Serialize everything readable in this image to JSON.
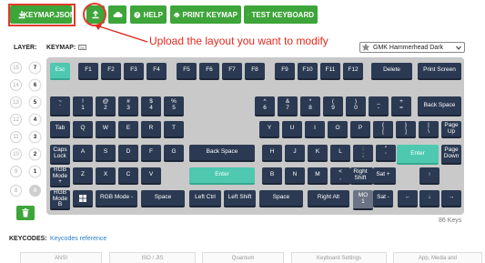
{
  "toolbar": {
    "keymap_json": "KEYMAP.JSON",
    "help": "HELP",
    "print_keymap": "PRINT KEYMAP",
    "test_keyboard": "TEST KEYBOARD"
  },
  "annotation": "Upload the layout you want to modify",
  "layer_label": "LAYER:",
  "keymap_label": "KEYMAP:",
  "theme_select": "GMK Hammerhead Dark",
  "keys_count": "86 Keys",
  "keycodes_label": "KEYCODES:",
  "keycodes_link": "Keycodes reference",
  "layers_left": [
    "15",
    "14",
    "13",
    "12",
    "11",
    "10",
    "9",
    "8"
  ],
  "layers_right": [
    "7",
    "6",
    "5",
    "4",
    "3",
    "2",
    "1",
    "0"
  ],
  "keys": {
    "esc": "Esc",
    "f1": "F1",
    "f2": "F2",
    "f3": "F3",
    "f4": "F4",
    "f5": "F5",
    "f6": "F6",
    "f7": "F7",
    "f8": "F8",
    "f9": "F9",
    "f10": "F10",
    "f11": "F11",
    "f12": "F12",
    "delete": "Delete",
    "printscreen": "Print Screen",
    "tilde": "~\n`",
    "n1": "!\n1",
    "n2": "@\n2",
    "n3": "#\n3",
    "n4": "$\n4",
    "n5": "%\n5",
    "n6": "^\n6",
    "n7": "&\n7",
    "n8": "*\n8",
    "n9": "(\n9",
    "n0": ")\n0",
    "minus": "_\n-",
    "equal": "+\n=",
    "backspace": "Back Space",
    "tab": "Tab",
    "q": "Q",
    "w": "W",
    "e": "E",
    "r": "R",
    "t": "T",
    "y": "Y",
    "u": "U",
    "i": "I",
    "o": "O",
    "p": "P",
    "lbr": "{\n[",
    "rbr": "}\n]",
    "bslash": "|\n\\",
    "pgup": "Page\nUp",
    "caps": "Caps\nLock",
    "a": "A",
    "s": "S",
    "d": "D",
    "f": "F",
    "g": "G",
    "bs2": "Back Space",
    "h": "H",
    "j": "J",
    "k": "K",
    "l": "L",
    "semi": ":\n;",
    "quote": "\"\n'",
    "enter": "Enter",
    "pgdn": "Page\nDown",
    "rgbmf": "RGB\nMode\n+",
    "z": "Z",
    "x": "X",
    "c": "C",
    "v": "V",
    "enter2": "Enter",
    "b": "B",
    "n": "N",
    "m": "M",
    "comma": "<\n,",
    "period": ">\n.",
    "slash": "?\n/",
    "rshift": "Right\nShift",
    "satplus": "Sat +",
    "rgbmb": "RGB\nMode\nB",
    "rgbminus": "RGB Mode -",
    "space1": "Space",
    "lctrl": "Left Ctrl",
    "lshift": "Left Shift",
    "space2": "Space",
    "ralt": "Right Alt",
    "mo": "MO\n1",
    "satminus": "Sat -",
    "left": "←",
    "down": "↓",
    "right": "→",
    "up": "↑"
  },
  "tabs": [
    "ANSI",
    "ISO / JIS",
    "Quantum",
    "Keyboard Settings",
    "App, Media and"
  ],
  "colors": {
    "toolbar_green": "#3ea53a",
    "annotation_red": "#e02a1e",
    "key_dark": "#2b3a52",
    "key_accent": "#4ec9b0"
  }
}
